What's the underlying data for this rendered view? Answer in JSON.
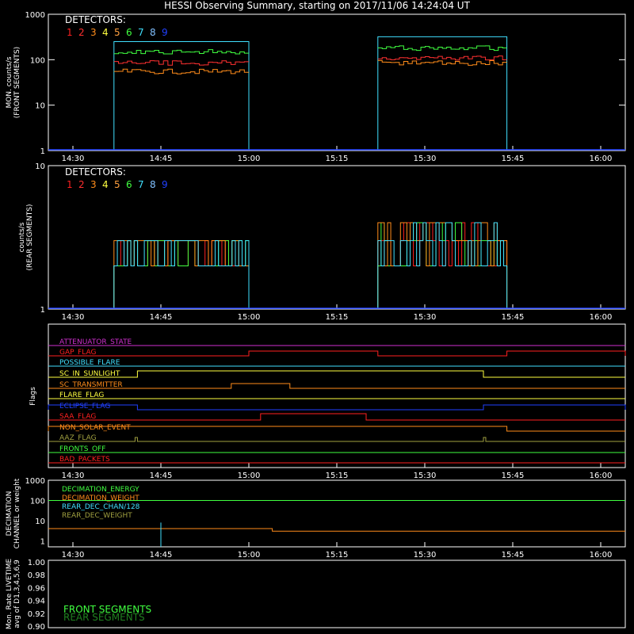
{
  "title": "HESSI Observing Summary, starting on 2017/11/06 14:24:04 UT",
  "time_ticks": [
    "14:30",
    "14:45",
    "15:00",
    "15:15",
    "15:30",
    "15:45",
    "16:00"
  ],
  "detector_colors": [
    "#ff2020",
    "#ff3030",
    "#ff8c1a",
    "#ffff40",
    "#ffa040",
    "#40ff40",
    "#40e0ff",
    "#80c0ff",
    "#2040ff"
  ],
  "chart_data": [
    {
      "type": "line",
      "panel": "front",
      "ylabel": "MON. counts/s (FRONT SEGMENTS)",
      "yscale": "log",
      "ylim": [
        1,
        1000
      ],
      "yticks": [
        "1",
        "10",
        "100",
        "1000"
      ],
      "xlim": [
        "14:24:04",
        "16:05"
      ],
      "legend_title": "DETECTORS:",
      "legend_numbers": [
        "1",
        "2",
        "3",
        "4",
        "5",
        "6",
        "7",
        "8",
        "9"
      ],
      "intervals": [
        [
          "14:37",
          "15:00"
        ],
        [
          "15:22",
          "15:44"
        ]
      ],
      "series": [
        {
          "color": "#40e0ff",
          "values": [
            250,
            320
          ]
        },
        {
          "color": "#40ff40",
          "values": [
            150,
            180
          ]
        },
        {
          "color": "#ff3030",
          "values": [
            85,
            110
          ]
        },
        {
          "color": "#ff8c1a",
          "values": [
            55,
            85
          ]
        }
      ]
    },
    {
      "type": "line",
      "panel": "rear",
      "ylabel": "counts/s (REAR SEGMENTS)",
      "yscale": "log",
      "ylim": [
        1,
        10
      ],
      "yticks": [
        "1",
        "10"
      ],
      "legend_title": "DETECTORS:",
      "legend_numbers": [
        "1",
        "2",
        "3",
        "4",
        "5",
        "6",
        "7",
        "8",
        "9"
      ],
      "intervals": [
        [
          "14:37",
          "15:00"
        ],
        [
          "15:22",
          "15:44"
        ]
      ],
      "levels": [
        2,
        3,
        4
      ]
    },
    {
      "type": "line",
      "panel": "flags",
      "ylabel": "Flags",
      "flags": [
        {
          "label": "ATTENUATOR_STATE",
          "color": "#d030d0"
        },
        {
          "label": "GAP_FLAG",
          "color": "#ff2020"
        },
        {
          "label": "POSSIBLE_FLARE",
          "color": "#40e0ff"
        },
        {
          "label": "SC_IN_SUNLIGHT",
          "color": "#ffff40"
        },
        {
          "label": "SC_TRANSMITTER",
          "color": "#ff8c1a"
        },
        {
          "label": "FLARE_FLAG",
          "color": "#ffff40"
        },
        {
          "label": "ECLIPSE_FLAG",
          "color": "#2040ff"
        },
        {
          "label": "SAA_FLAG",
          "color": "#ff2020"
        },
        {
          "label": "NON_SOLAR_EVENT",
          "color": "#ff8c1a"
        },
        {
          "label": "AAZ_FLAG",
          "color": "#a0a040"
        },
        {
          "label": "FRONTS_OFF",
          "color": "#40ff40"
        },
        {
          "label": "BAD_PACKETS",
          "color": "#ff2020"
        }
      ]
    },
    {
      "type": "line",
      "panel": "decimation",
      "ylabel": "DECIMATION CHANNEL or weight",
      "yscale": "log",
      "ylim": [
        0.5,
        1000
      ],
      "yticks": [
        "1",
        "10",
        "100",
        "1000"
      ],
      "legend": [
        {
          "label": "DECIMATION_ENERGY",
          "color": "#40ff40"
        },
        {
          "label": "DECIMATION_WEIGHT",
          "color": "#ff8c1a"
        },
        {
          "label": "REAR_DEC_CHAN/128",
          "color": "#40e0ff"
        },
        {
          "label": "REAR_DEC_WEIGHT",
          "color": "#a0a040"
        }
      ]
    },
    {
      "type": "line",
      "panel": "livetime",
      "ylabel": "Mon. Rate LIVETIME avg of D1,3,4,5,6,9",
      "ylim": [
        0.9,
        1.0
      ],
      "yticks": [
        "0.90",
        "0.92",
        "0.94",
        "0.96",
        "0.98",
        "1.00"
      ],
      "legend": [
        {
          "label": "FRONT SEGMENTS",
          "color": "#40ff40"
        },
        {
          "label": "REAR SEGMENTS",
          "color": "#208020"
        }
      ]
    }
  ]
}
